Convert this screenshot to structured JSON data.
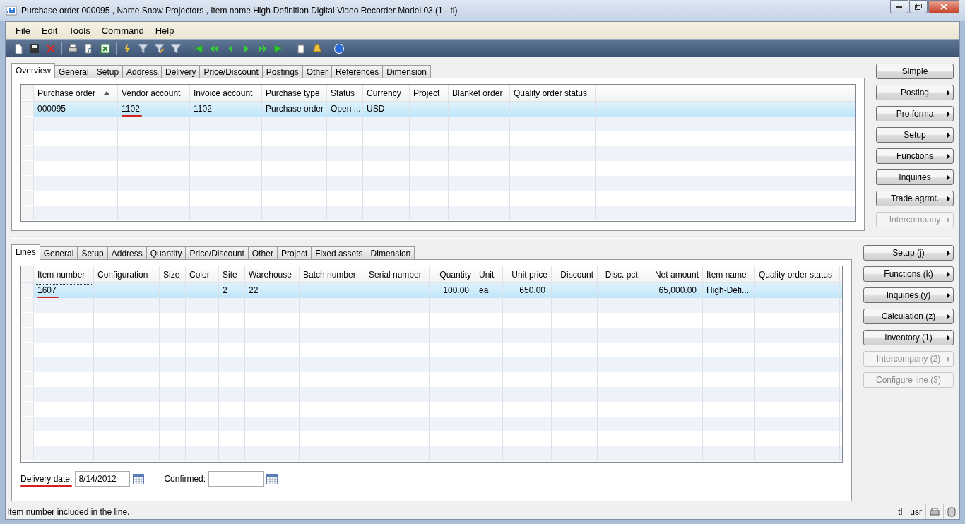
{
  "window": {
    "title": "Purchase order 000095 , Name Snow Projectors , Item name High-Definition Digital Video Recorder Model 03 (1 - tl)"
  },
  "menu": [
    "File",
    "Edit",
    "Tools",
    "Command",
    "Help"
  ],
  "header": {
    "tabs": [
      {
        "label": "Overview",
        "selected": true
      },
      {
        "label": "General",
        "selected": false
      },
      {
        "label": "Setup",
        "selected": false
      },
      {
        "label": "Address",
        "selected": false
      },
      {
        "label": "Delivery",
        "selected": false
      },
      {
        "label": "Price/Discount",
        "selected": false
      },
      {
        "label": "Postings",
        "selected": false
      },
      {
        "label": "Other",
        "selected": false
      },
      {
        "label": "References",
        "selected": false
      },
      {
        "label": "Dimension",
        "selected": false
      }
    ],
    "columns": [
      {
        "label": "Purchase order",
        "sorted": true
      },
      {
        "label": "Vendor account",
        "sorted": false
      },
      {
        "label": "Invoice account",
        "sorted": false
      },
      {
        "label": "Purchase type",
        "sorted": false
      },
      {
        "label": "Status",
        "sorted": false
      },
      {
        "label": "Currency",
        "sorted": false
      },
      {
        "label": "Project",
        "sorted": false
      },
      {
        "label": "Blanket order",
        "sorted": false
      },
      {
        "label": "Quality order status",
        "sorted": false
      }
    ],
    "rows": [
      {
        "selected": true,
        "cells": [
          {
            "text": "000095",
            "underlined": false
          },
          {
            "text": "1102",
            "underlined": true
          },
          {
            "text": "1102",
            "underlined": false
          },
          {
            "text": "Purchase order",
            "underlined": false
          },
          {
            "text": "Open ...",
            "underlined": false
          },
          {
            "text": "USD",
            "underlined": false
          },
          null,
          null,
          null
        ]
      }
    ],
    "buttons": [
      {
        "label": "Simple",
        "menu": false,
        "disabled": false
      },
      {
        "label": "Posting",
        "menu": true,
        "disabled": false
      },
      {
        "label": "Pro forma",
        "menu": true,
        "disabled": false
      },
      {
        "label": "Setup",
        "menu": true,
        "disabled": false
      },
      {
        "label": "Functions",
        "menu": true,
        "disabled": false
      },
      {
        "label": "Inquiries",
        "menu": true,
        "disabled": false
      },
      {
        "label": "Trade agrmt.",
        "menu": true,
        "disabled": false
      },
      {
        "label": "Intercompany",
        "menu": true,
        "disabled": true
      }
    ]
  },
  "lines": {
    "tabs": [
      {
        "label": "Lines",
        "selected": true
      },
      {
        "label": "General",
        "selected": false
      },
      {
        "label": "Setup",
        "selected": false
      },
      {
        "label": "Address",
        "selected": false
      },
      {
        "label": "Quantity",
        "selected": false
      },
      {
        "label": "Price/Discount",
        "selected": false
      },
      {
        "label": "Other",
        "selected": false
      },
      {
        "label": "Project",
        "selected": false
      },
      {
        "label": "Fixed assets",
        "selected": false
      },
      {
        "label": "Dimension",
        "selected": false
      }
    ],
    "columns": [
      {
        "label": "Item number",
        "sorted": false
      },
      {
        "label": "Configuration",
        "sorted": false
      },
      {
        "label": "Size",
        "sorted": false
      },
      {
        "label": "Color",
        "sorted": false
      },
      {
        "label": "Site",
        "sorted": false
      },
      {
        "label": "Warehouse",
        "sorted": false
      },
      {
        "label": "Batch number",
        "sorted": false
      },
      {
        "label": "Serial number",
        "sorted": false
      },
      {
        "label": "Quantity",
        "sorted": false
      },
      {
        "label": "Unit",
        "sorted": false
      },
      {
        "label": "Unit price",
        "sorted": false
      },
      {
        "label": "Discount",
        "sorted": false
      },
      {
        "label": "Disc. pct.",
        "sorted": false
      },
      {
        "label": "Net amount",
        "sorted": false
      },
      {
        "label": "Item name",
        "sorted": false
      },
      {
        "label": "Quality order status",
        "sorted": false
      }
    ],
    "rows": [
      {
        "selected": true,
        "cells": [
          {
            "text": "1607",
            "underlined": true
          },
          null,
          null,
          null,
          {
            "text": "2",
            "underlined": false
          },
          {
            "text": "22",
            "underlined": false
          },
          null,
          null,
          {
            "text": "100.00",
            "underlined": false
          },
          {
            "text": "ea",
            "underlined": false
          },
          {
            "text": "650.00",
            "underlined": false
          },
          null,
          null,
          {
            "text": "65,000.00",
            "underlined": false
          },
          {
            "text": "High-Defi...",
            "underlined": false
          },
          null
        ]
      }
    ],
    "delivery_date": {
      "label": "Delivery date:",
      "value": "8/14/2012",
      "underlined": true
    },
    "confirmed": {
      "label": "Confirmed:"
    },
    "buttons": [
      {
        "label": "Setup (j)",
        "menu": true,
        "disabled": false
      },
      {
        "label": "Functions (k)",
        "menu": true,
        "disabled": false
      },
      {
        "label": "Inquiries (y)",
        "menu": true,
        "disabled": false
      },
      {
        "label": "Calculation (z)",
        "menu": true,
        "disabled": false
      },
      {
        "label": "Inventory (1)",
        "menu": true,
        "disabled": false
      },
      {
        "label": "Intercompany (2)",
        "menu": true,
        "disabled": true
      },
      {
        "label": "Configure line (3)",
        "menu": false,
        "disabled": true
      }
    ]
  },
  "status_bar": {
    "message": "Item number included in the line.",
    "company": "tl",
    "user": "usr"
  }
}
